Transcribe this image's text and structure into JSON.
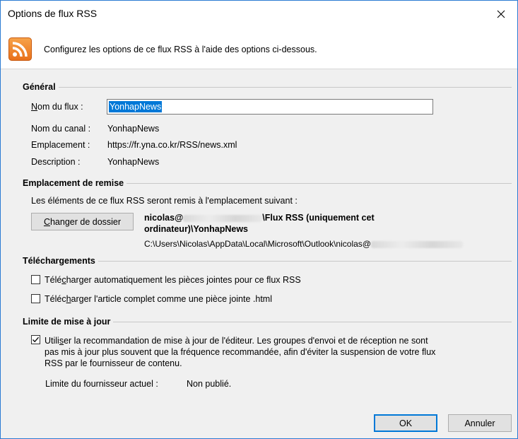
{
  "window": {
    "title": "Options de flux RSS"
  },
  "header": {
    "description": "Configurez les options de ce flux RSS à l'aide des options ci-dessous."
  },
  "general": {
    "title": "Général",
    "feed_name_label": "Nom du flux :",
    "feed_name_value": "YonhapNews",
    "channel_label": "Nom du canal :",
    "channel_value": "YonhapNews",
    "location_label": "Emplacement :",
    "location_value": "https://fr.yna.co.kr/RSS/news.xml",
    "description_label": "Description :",
    "description_value": "YonhapNews"
  },
  "delivery": {
    "title": "Emplacement de remise",
    "info": "Les éléments de ce flux RSS seront remis à l'emplacement suivant :",
    "change_folder_button": "Changer de dossier",
    "folder_prefix": "nicolas@",
    "folder_suffix": "\\Flux RSS (uniquement cet",
    "folder_line2": "ordinateur)\\YonhapNews",
    "path_prefix": "C:\\Users\\Nicolas\\AppData\\Local\\Microsoft\\Outlook\\nicolas@"
  },
  "downloads": {
    "title": "Téléchargements",
    "auto_attachments_label": "Télécharger automatiquement les pièces jointes pour ce flux RSS",
    "auto_attachments_checked": false,
    "full_article_label": "Télécharger l'article complet comme une pièce jointe .html",
    "full_article_checked": false
  },
  "update_limit": {
    "title": "Limite de mise à jour",
    "use_recommendation_label_line1": "Utiliser la recommandation de mise à jour de l'éditeur. Les groupes d'envoi et de réception ne sont",
    "use_recommendation_label_line2": "pas mis à jour plus souvent que la fréquence recommandée, afin d'éviter la suspension de votre flux",
    "use_recommendation_label_line3": "RSS par le fournisseur de contenu.",
    "use_recommendation_checked": true,
    "current_limit_label": "Limite du fournisseur actuel :",
    "current_limit_value": "Non publié."
  },
  "footer": {
    "ok_label": "OK",
    "cancel_label": "Annuler"
  }
}
